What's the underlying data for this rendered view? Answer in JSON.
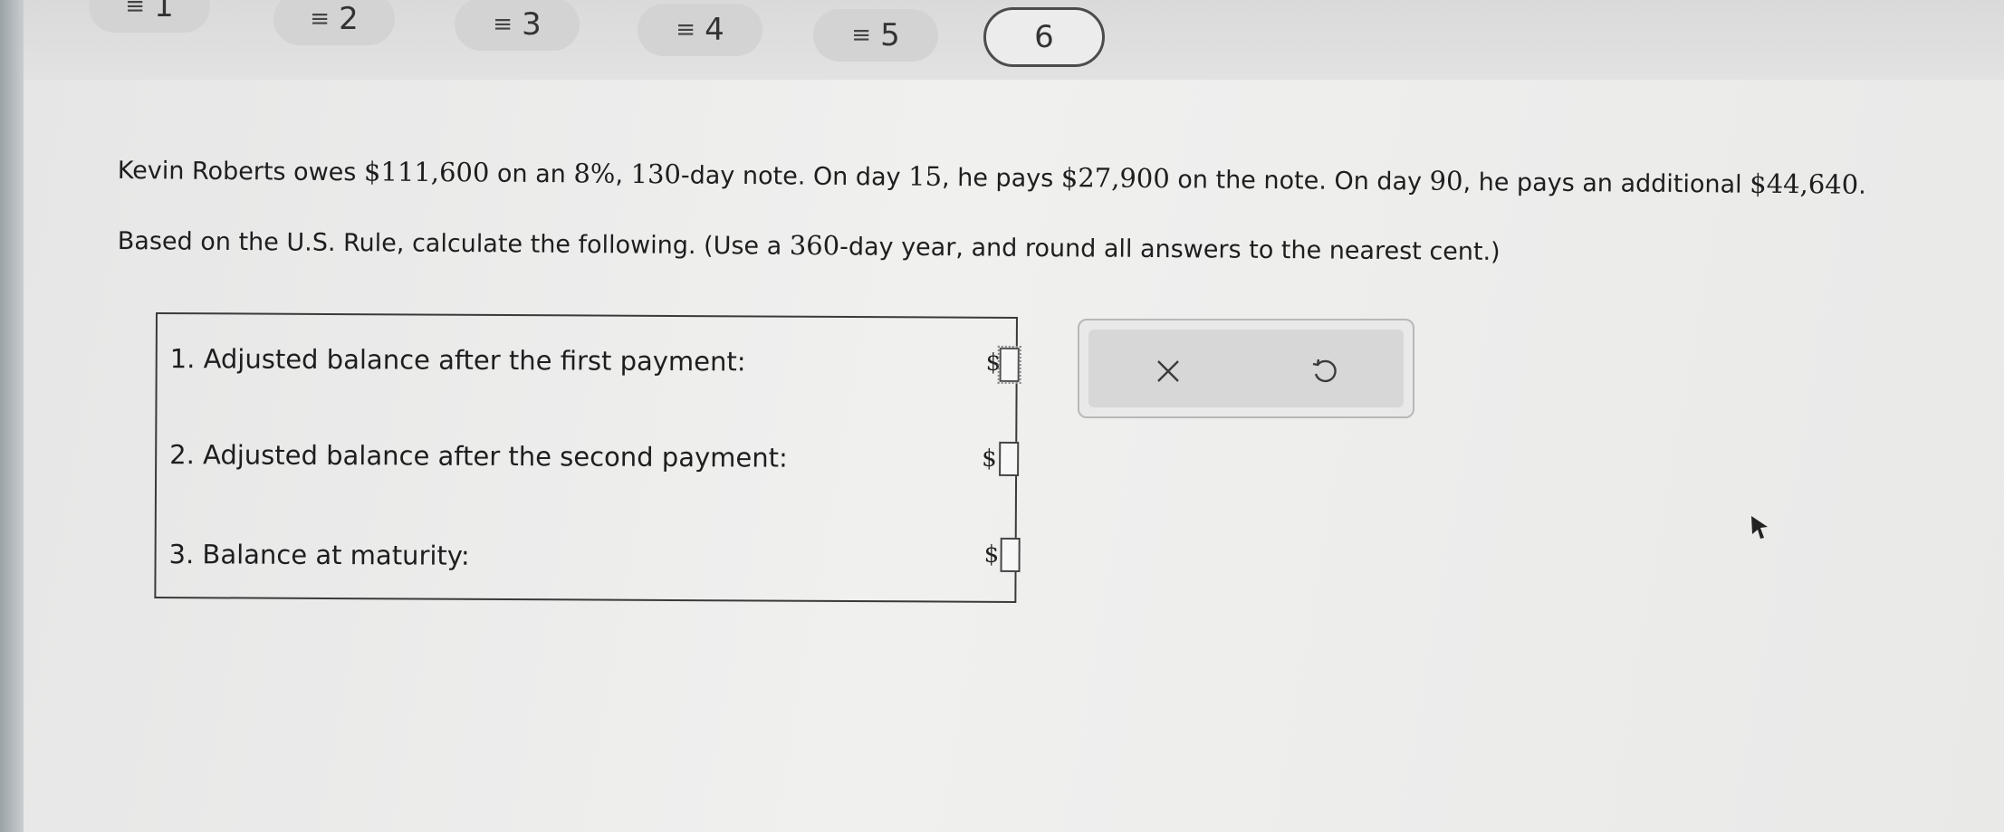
{
  "tabs": [
    {
      "label": "1",
      "icon": "equals-icon"
    },
    {
      "label": "2",
      "icon": "equals-icon"
    },
    {
      "label": "3",
      "icon": "equals-icon"
    },
    {
      "label": "4",
      "icon": "equals-icon"
    },
    {
      "label": "5",
      "icon": "equals-icon"
    },
    {
      "label": "6",
      "active": true
    }
  ],
  "problem": {
    "line1": {
      "t1": "Kevin Roberts owes ",
      "amount": "$111,600",
      "t2": " on an ",
      "rate": "8%",
      "t3": ", ",
      "days": "130",
      "t4": "-day note. On day ",
      "day1": "15",
      "t5": ", he pays ",
      "pay1": "$27,900",
      "t6": " on the note. On day ",
      "day2": "90",
      "t7": ", he pays an additional ",
      "pay2": "$44,640",
      "t8": "."
    },
    "line2": {
      "t1": "Based on the U.S. Rule, calculate the following. (Use a ",
      "year": "360",
      "t2": "-day year, and round all answers to the nearest cent.)"
    }
  },
  "questions": [
    {
      "label": "1. Adjusted balance after the first payment:",
      "currency": "$",
      "value": ""
    },
    {
      "label": "2. Adjusted balance after the second payment:",
      "currency": "$",
      "value": ""
    },
    {
      "label": "3. Balance at maturity:",
      "currency": "$",
      "value": ""
    }
  ],
  "tools": {
    "clear_icon": "close-icon",
    "undo_icon": "undo-icon"
  },
  "colors": {
    "background": "#ececec",
    "tab_fill": "#d3d3d3",
    "active_tab_border": "#4c4c4c",
    "tool_panel": "#d7d7d7"
  }
}
